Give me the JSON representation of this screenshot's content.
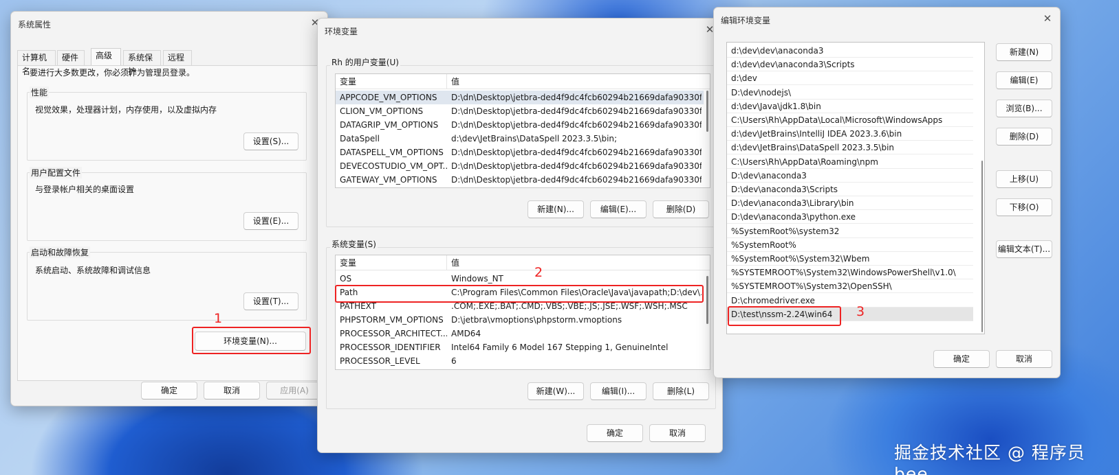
{
  "watermark": "掘金技术社区 @ 程序员bee",
  "sys_props": {
    "title": "系统属性",
    "tabs": [
      "计算机名",
      "硬件",
      "高级",
      "系统保护",
      "远程"
    ],
    "active_tab": "高级",
    "admin_note": "要进行大多数更改，你必须作为管理员登录。",
    "perf": {
      "label": "性能",
      "desc": "视觉效果，处理器计划，内存使用，以及虚拟内存",
      "button": "设置(S)..."
    },
    "profile": {
      "label": "用户配置文件",
      "desc": "与登录帐户相关的桌面设置",
      "button": "设置(E)..."
    },
    "startup": {
      "label": "启动和故障恢复",
      "desc": "系统启动、系统故障和调试信息",
      "button": "设置(T)..."
    },
    "env_button": "环境变量(N)...",
    "ok": "确定",
    "cancel": "取消",
    "apply": "应用(A)"
  },
  "env_vars": {
    "title": "环境变量",
    "user_group_label": "Rh 的用户变量(U)",
    "columns": [
      "变量",
      "值"
    ],
    "user_vars": [
      [
        "APPCODE_VM_OPTIONS",
        "D:\\dn\\Desktop\\jetbra-ded4f9dc4fcb60294b21669dafa90330f..."
      ],
      [
        "CLION_VM_OPTIONS",
        "D:\\dn\\Desktop\\jetbra-ded4f9dc4fcb60294b21669dafa90330f..."
      ],
      [
        "DATAGRIP_VM_OPTIONS",
        "D:\\dn\\Desktop\\jetbra-ded4f9dc4fcb60294b21669dafa90330f..."
      ],
      [
        "DataSpell",
        "d:\\dev\\JetBrains\\DataSpell 2023.3.5\\bin;"
      ],
      [
        "DATASPELL_VM_OPTIONS",
        "D:\\dn\\Desktop\\jetbra-ded4f9dc4fcb60294b21669dafa90330f..."
      ],
      [
        "DEVECOSTUDIO_VM_OPT...",
        "D:\\dn\\Desktop\\jetbra-ded4f9dc4fcb60294b21669dafa90330f..."
      ],
      [
        "GATEWAY_VM_OPTIONS",
        "D:\\dn\\Desktop\\jetbra-ded4f9dc4fcb60294b21669dafa90330f..."
      ]
    ],
    "user_buttons": [
      "新建(N)...",
      "编辑(E)...",
      "删除(D)"
    ],
    "sys_group_label": "系统变量(S)",
    "sys_vars": [
      [
        "OS",
        "Windows_NT"
      ],
      [
        "Path",
        "C:\\Program Files\\Common Files\\Oracle\\Java\\javapath;D:\\dev\\..."
      ],
      [
        "PATHEXT",
        ".COM;.EXE;.BAT;.CMD;.VBS;.VBE;.JS;.JSE;.WSF;.WSH;.MSC"
      ],
      [
        "PHPSTORM_VM_OPTIONS",
        "D:\\jetbra\\vmoptions\\phpstorm.vmoptions"
      ],
      [
        "PROCESSOR_ARCHITECT...",
        "AMD64"
      ],
      [
        "PROCESSOR_IDENTIFIER",
        "Intel64 Family 6 Model 167 Stepping 1, GenuineIntel"
      ],
      [
        "PROCESSOR_LEVEL",
        "6"
      ]
    ],
    "sys_buttons": [
      "新建(W)...",
      "编辑(I)...",
      "删除(L)"
    ],
    "ok": "确定",
    "cancel": "取消"
  },
  "edit_env": {
    "title": "编辑环境变量",
    "paths": [
      "d:\\dev\\dev\\anaconda3",
      "d:\\dev\\dev\\anaconda3\\Scripts",
      "d:\\dev",
      "D:\\dev\\nodejs\\",
      "d:\\dev\\Java\\jdk1.8\\bin",
      "C:\\Users\\Rh\\AppData\\Local\\Microsoft\\WindowsApps",
      "d:\\dev\\JetBrains\\IntelliJ IDEA 2023.3.6\\bin",
      "d:\\dev\\JetBrains\\DataSpell 2023.3.5\\bin",
      "C:\\Users\\Rh\\AppData\\Roaming\\npm",
      "D:\\dev\\anaconda3",
      "D:\\dev\\anaconda3\\Scripts",
      "D:\\dev\\anaconda3\\Library\\bin",
      "D:\\dev\\anaconda3\\python.exe",
      "%SystemRoot%\\system32",
      "%SystemRoot%",
      "%SystemRoot%\\System32\\Wbem",
      "%SYSTEMROOT%\\System32\\WindowsPowerShell\\v1.0\\",
      "%SYSTEMROOT%\\System32\\OpenSSH\\",
      "D:\\chromedriver.exe",
      "D:\\test\\nssm-2.24\\win64"
    ],
    "buttons": [
      "新建(N)",
      "编辑(E)",
      "浏览(B)...",
      "删除(D)",
      "上移(U)",
      "下移(O)",
      "编辑文本(T)..."
    ],
    "ok": "确定",
    "cancel": "取消"
  },
  "annotations": [
    "1",
    "2",
    "3"
  ],
  "annotation_color": "#e22222"
}
